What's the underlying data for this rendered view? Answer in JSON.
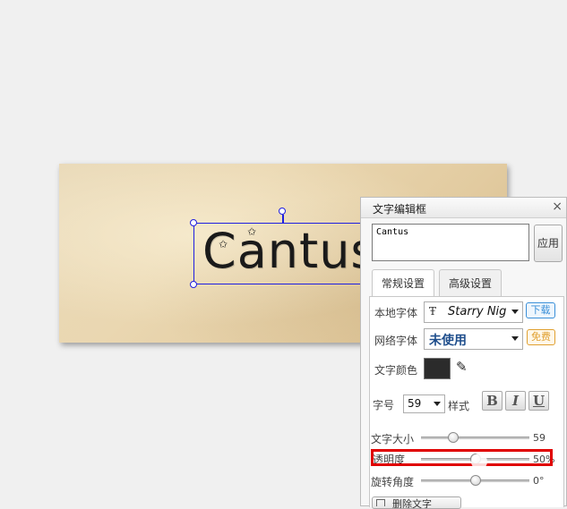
{
  "canvas": {
    "text": "Cantus"
  },
  "panel": {
    "title": "文字编辑框",
    "close": "×",
    "textarea_value": "Cantus",
    "apply_label": "应用",
    "tabs": [
      {
        "label": "常规设置",
        "active": true
      },
      {
        "label": "高级设置",
        "active": false
      }
    ],
    "local_font": {
      "label": "本地字体",
      "value": "Starry Nig",
      "badge": "下载"
    },
    "web_font": {
      "label": "网络字体",
      "value": "未使用",
      "badge": "免费"
    },
    "text_color": {
      "label": "文字颜色",
      "color": "#2b2b2b",
      "eyedropper_icon": "eyedropper-icon"
    },
    "font_size": {
      "label": "字号",
      "value": "59",
      "style_label": "样式",
      "bold": "B",
      "italic": "I",
      "underline": "U"
    },
    "sliders": [
      {
        "label": "文字大小",
        "value": 59,
        "display": "59",
        "fraction": 0.3
      },
      {
        "label": "透明度",
        "value": 50,
        "display": "50%",
        "fraction": 0.5
      },
      {
        "label": "旋转角度",
        "value": 0,
        "display": "0°",
        "fraction": 0.5
      }
    ],
    "bottom_button": "删除文字"
  },
  "colors": {
    "selection": "#1f1fe0",
    "highlight": "#e00000",
    "download_badge": "#3a8fd8",
    "free_badge": "#e0a030"
  }
}
